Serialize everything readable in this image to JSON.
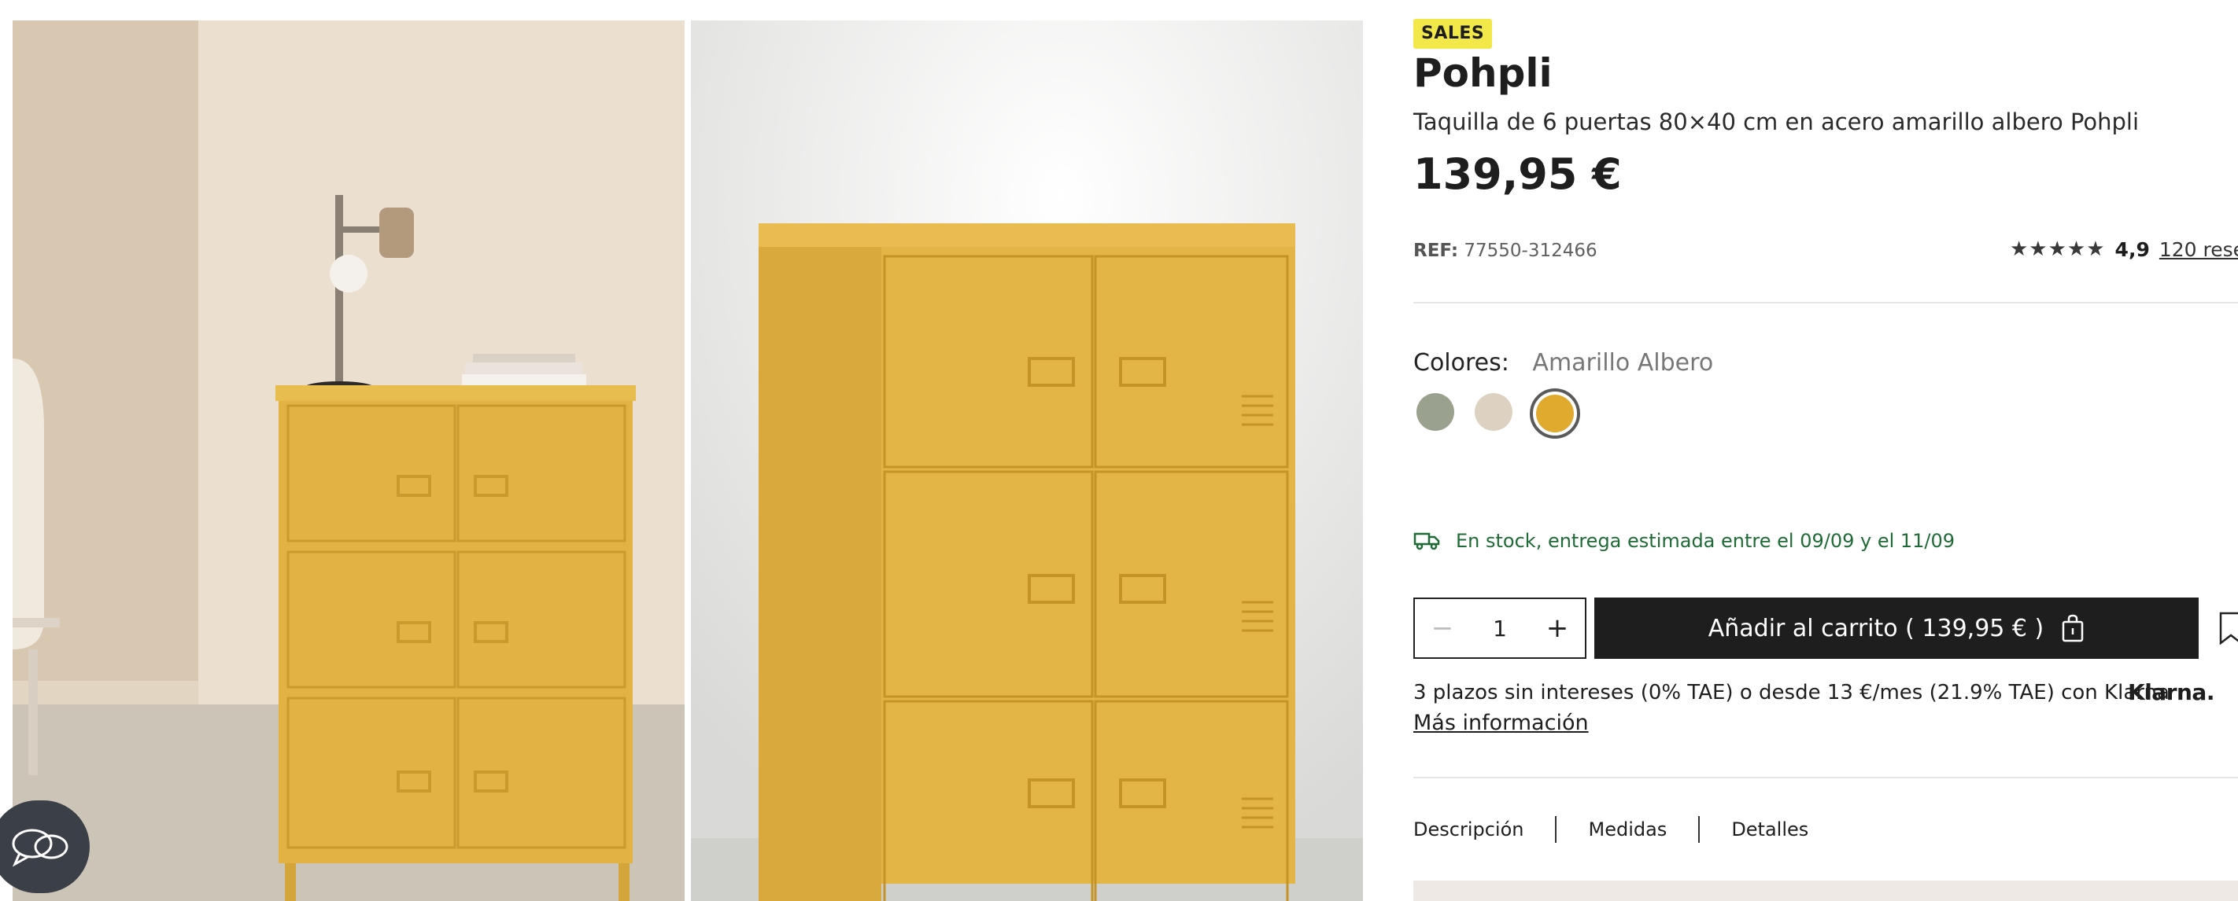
{
  "product": {
    "badge": "SALES",
    "brand": "Pohpli",
    "subtitle": "Taquilla de 6 puertas 80×40 cm en acero amarillo albero Pohpli",
    "price": "139,95 €",
    "ref_label": "REF:",
    "ref_value": "77550-312466",
    "rating_stars": "★★★★★",
    "rating_score": "4,9",
    "reviews_link": "120 rese"
  },
  "colors": {
    "label": "Colores:",
    "selected_name": "Amarillo Albero",
    "swatches": [
      {
        "name": "green-grey",
        "hex": "#9aa18f"
      },
      {
        "name": "beige",
        "hex": "#ddd2c2"
      },
      {
        "name": "amarillo-albero",
        "hex": "#e0aa2e",
        "selected": true
      }
    ]
  },
  "stock": {
    "icon": "truck-icon",
    "text": "En stock, entrega estimada entre el 09/09 y el 11/09"
  },
  "purchase": {
    "minus": "−",
    "quantity": "1",
    "plus": "+",
    "cart_label": "Añadir al carrito ( 139,95 € )",
    "cart_icon": "shopping-bag-icon"
  },
  "financing": {
    "text": "3 plazos sin intereses (0% TAE) o desde 13 €/mes (21.9% TAE) con Klarna",
    "logo": "Klarna.",
    "more_info": "Más información"
  },
  "tabs": [
    "Descripción",
    "Medidas",
    "Detalles"
  ],
  "gallery": {
    "cabinet_color": "#e2b245",
    "photo1_bg": "#e6d9c8",
    "photo2_bg": "#e9e9e7"
  },
  "colors_theme": {
    "accent_badge": "#f3e84a",
    "stock_green": "#1e6b36",
    "button_dark": "#1e1e1e"
  }
}
